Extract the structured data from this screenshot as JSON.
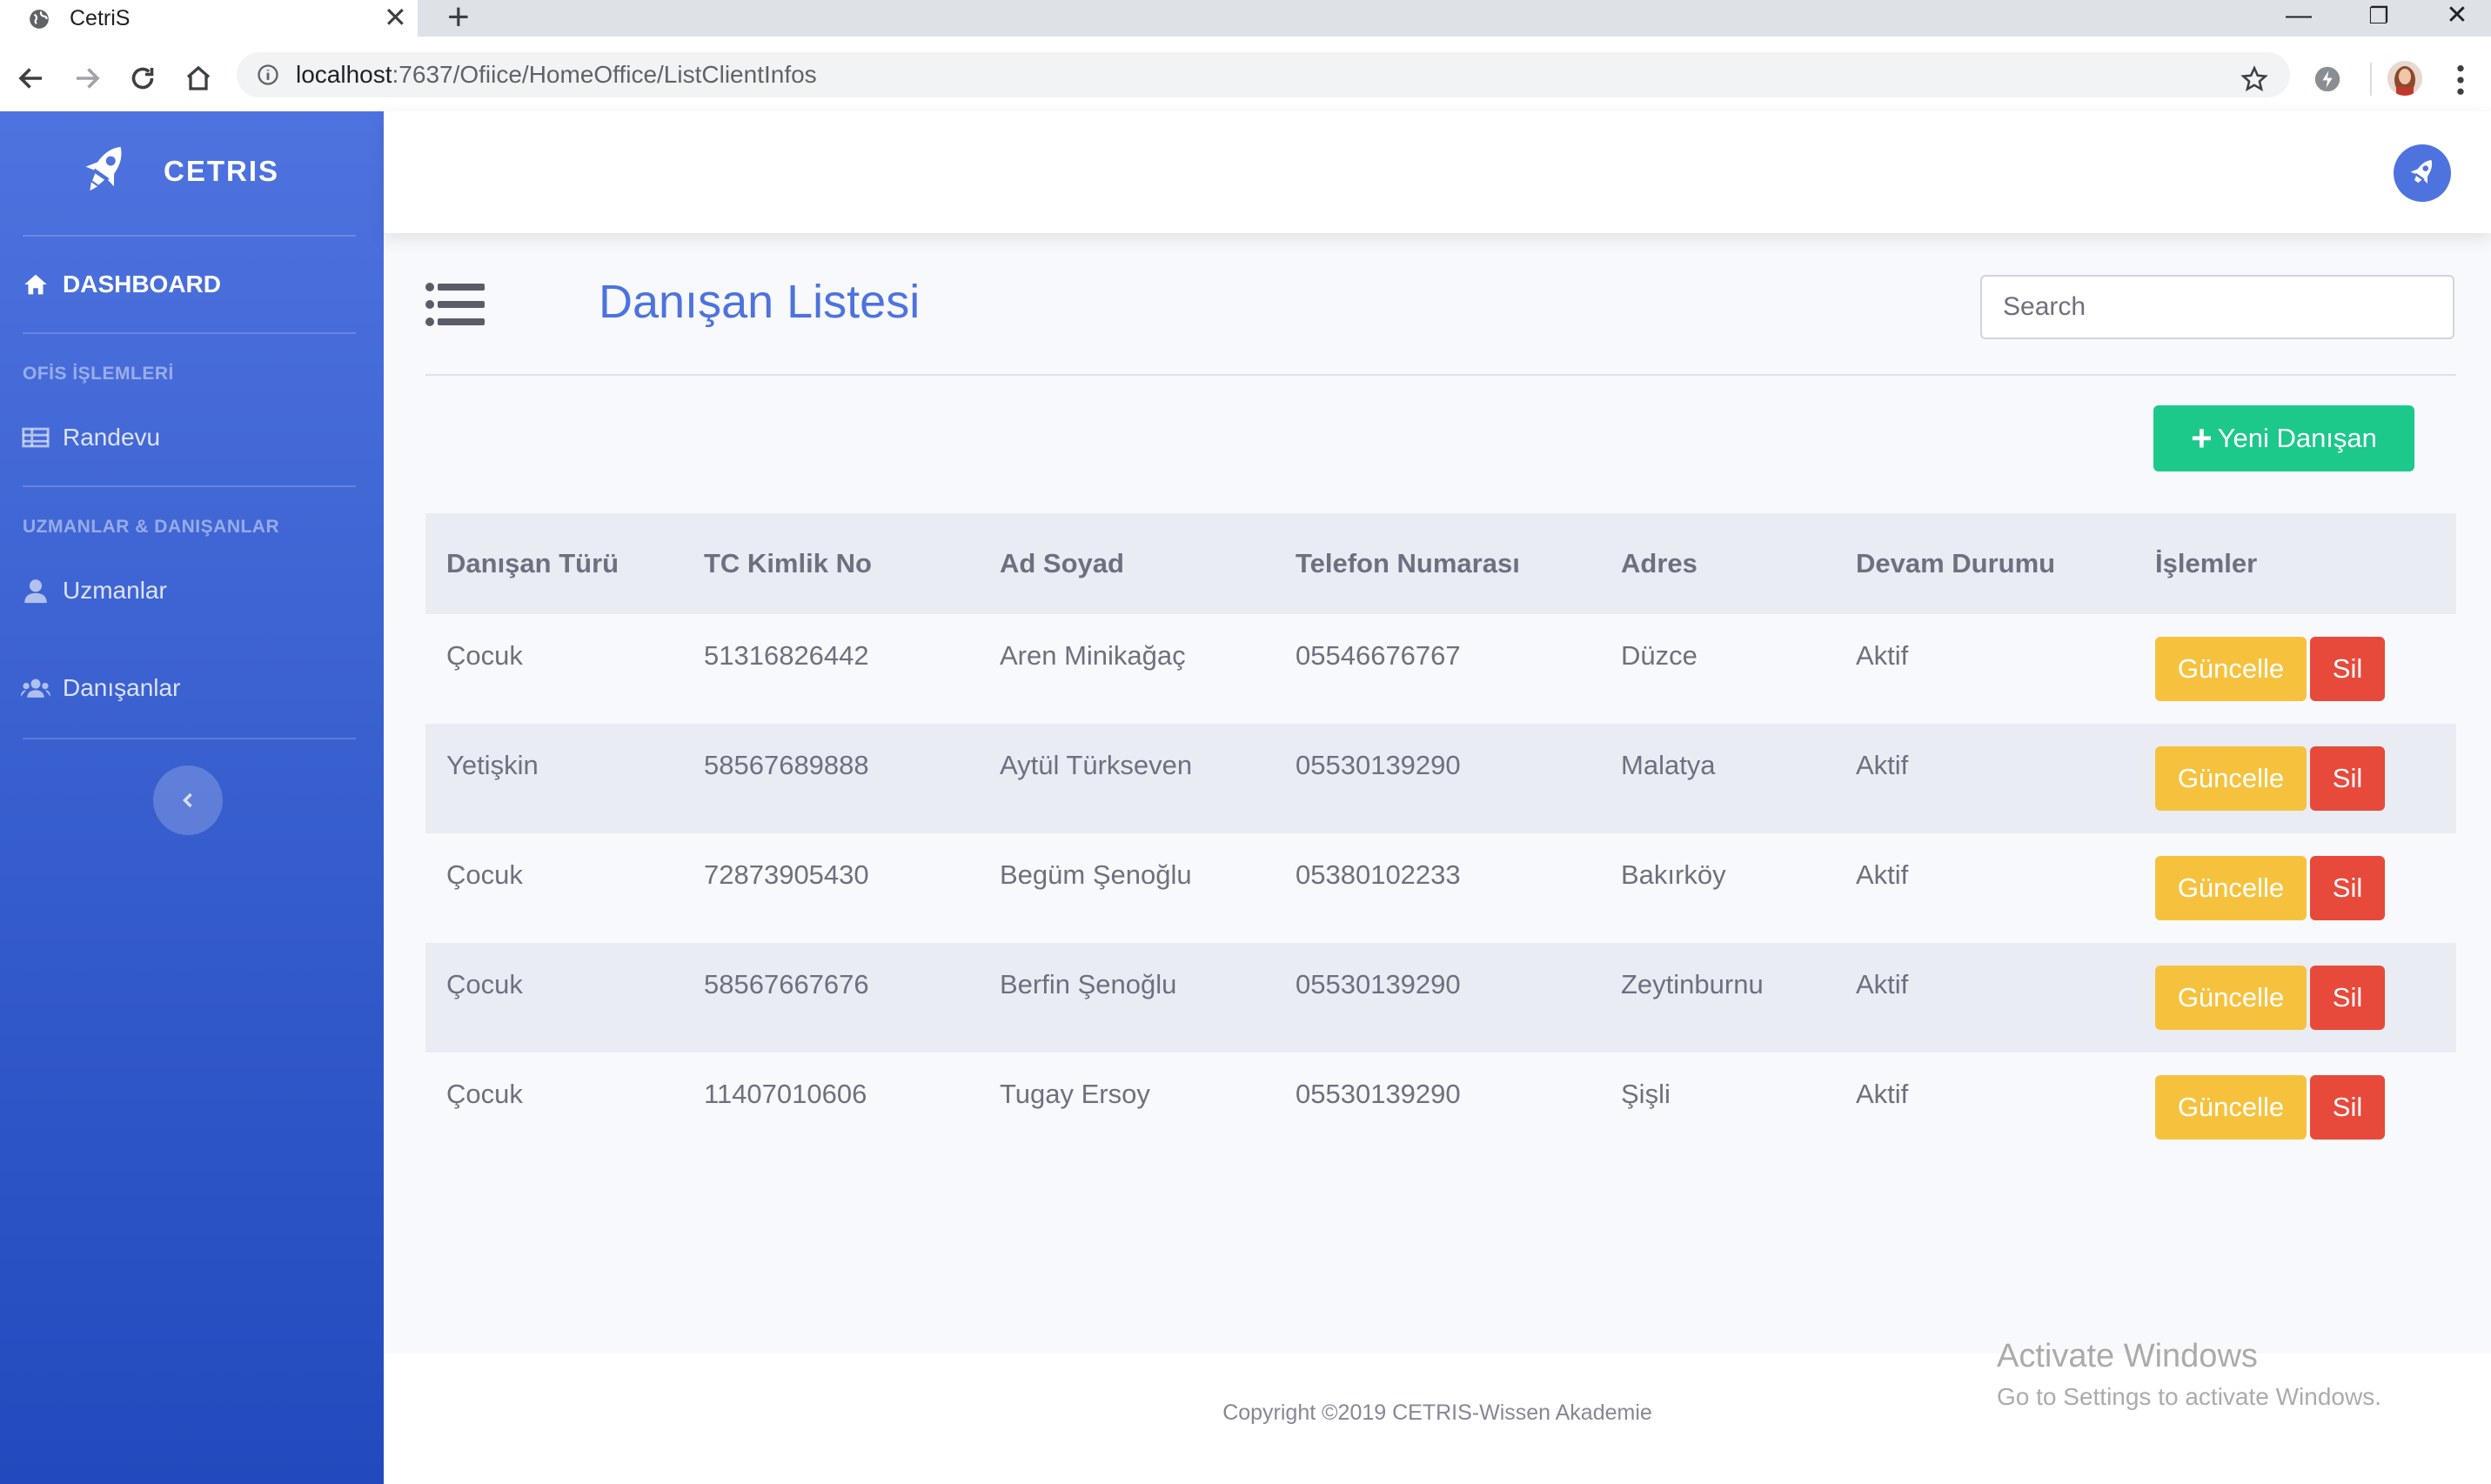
{
  "browser": {
    "tab_title": "CetriS",
    "url_host": "localhost",
    "url_rest": ":7637/Ofiice/HomeOffice/ListClientInfos"
  },
  "sidebar": {
    "brand": "CETRIS",
    "dashboard": "DASHBOARD",
    "section_office": "OFİS İŞLEMLERİ",
    "randevu": "Randevu",
    "section_experts": "UZMANLAR & DANIŞANLAR",
    "uzmanlar": "Uzmanlar",
    "danisanlar": "Danışanlar"
  },
  "main": {
    "title": "Danışan Listesi",
    "search_placeholder": "Search",
    "new_button": "Yeni Danışan",
    "columns": [
      "Danışan Türü",
      "TC Kimlik No",
      "Ad Soyad",
      "Telefon Numarası",
      "Adres",
      "Devam Durumu",
      "İşlemler"
    ],
    "rows": [
      {
        "type": "Çocuk",
        "tc": "51316826442",
        "name": "Aren Minikağaç",
        "phone": "05546676767",
        "address": "Düzce",
        "status": "Aktif"
      },
      {
        "type": "Yetişkin",
        "tc": "58567689888",
        "name": "Aytül Türkseven",
        "phone": "05530139290",
        "address": "Malatya",
        "status": "Aktif"
      },
      {
        "type": "Çocuk",
        "tc": "72873905430",
        "name": "Begüm Şenoğlu",
        "phone": "05380102233",
        "address": "Bakırköy",
        "status": "Aktif"
      },
      {
        "type": "Çocuk",
        "tc": "58567667676",
        "name": "Berfin Şenoğlu",
        "phone": "05530139290",
        "address": "Zeytinburnu",
        "status": "Aktif"
      },
      {
        "type": "Çocuk",
        "tc": "11407010606",
        "name": "Tugay Ersoy",
        "phone": "05530139290",
        "address": "Şişli",
        "status": "Aktif"
      }
    ],
    "update_label": "Güncelle",
    "delete_label": "Sil"
  },
  "footer": {
    "copyright": "Copyright ©2019 CETRIS-Wissen Akademie"
  },
  "watermark": {
    "line1": "Activate Windows",
    "line2": "Go to Settings to activate Windows."
  },
  "colors": {
    "primary": "#4e73df",
    "success": "#1cc88a",
    "warning": "#f6c23e",
    "danger": "#e74a3b"
  },
  "icons": [
    "globe-icon",
    "close-icon",
    "plus-icon",
    "back-icon",
    "forward-icon",
    "reload-icon",
    "home-icon",
    "info-icon",
    "star-icon",
    "extension-icon",
    "menu-icon",
    "rocket-icon",
    "table-icon",
    "user-icon",
    "users-icon",
    "chevron-left-icon",
    "list-icon"
  ]
}
